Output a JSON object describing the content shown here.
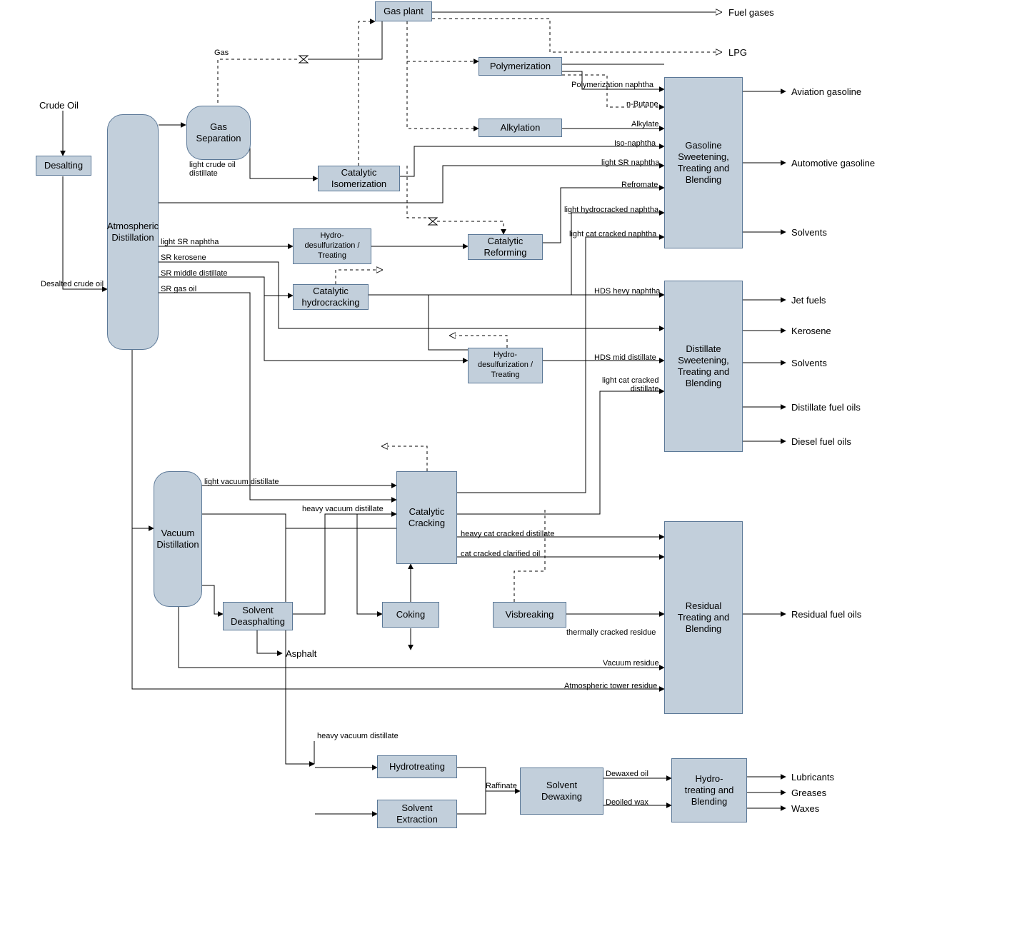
{
  "input": {
    "crude_oil": "Crude Oil"
  },
  "units": {
    "desalting": "Desalting",
    "gas_separation": "Gas\nSeparation",
    "gas_plant": "Gas plant",
    "catalytic_isomerization": "Catalytic\nIsomerization",
    "polymerization": "Polymerization",
    "alkylation": "Alkylation",
    "atmospheric_distillation": "Atmospheric\nDistillation",
    "hydro_desulf_1": "Hydro-\ndesulfurization /\nTreating",
    "catalytic_reforming": "Catalytic\nReforming",
    "catalytic_hydrocracking": "Catalytic\nhydrocracking",
    "hydro_desulf_2": "Hydro-\ndesulfurization /\nTreating",
    "vacuum_distillation": "Vacuum\nDistillation",
    "solvent_deasphalting": "Solvent\nDeasphalting",
    "catalytic_cracking": "Catalytic\nCracking",
    "coking": "Coking",
    "visbreaking": "Visbreaking",
    "hydrotreating": "Hydrotreating",
    "solvent_extraction": "Solvent\nExtraction",
    "solvent_dewaxing": "Solvent\nDewaxing",
    "hydro_treating_blending": "Hydro-\ntreating and\nBlending",
    "gasoline_blend": "Gasoline\nSweetening,\nTreating and\nBlending",
    "distillate_blend": "Distillate\nSweetening,\nTreating and\nBlending",
    "residual_blend": "Residual\nTreating and\nBlending"
  },
  "streams": {
    "gas": "Gas",
    "light_crude_oil_distillate": "light crude oil\ndistillate",
    "desalted_crude": "Desalted crude oil",
    "light_sr_naphtha_1": "light SR naphtha",
    "sr_kerosene": "SR kerosene",
    "sr_mid_dist": "SR middle distillate",
    "sr_gas_oil": "SR gas oil",
    "poly_naphtha": "Polymerization naphtha",
    "n_butane": "n-Butane",
    "alkylate": "Alkylate",
    "iso_naphtha": "Iso-naphtha",
    "light_sr_naphtha_2": "light SR naphtha",
    "refromate": "Refromate",
    "light_hydro_naphtha": "light hydrocracked naphtha",
    "light_cat_naphtha": "light cat cracked naphtha",
    "hds_heavy_naphtha": "HDS hevy naphtha",
    "hds_mid_distillate": "HDS mid distillate",
    "light_cat_distillate": "light cat cracked\ndistillate",
    "light_vac_distillate": "light vacuum distillate",
    "heavy_vac_distillate_1": "heavy vacuum distillate",
    "heavy_cat_distillate": "heavy cat cracked distillate",
    "cat_clarified_oil": "cat cracked clarified oil",
    "therm_cracked_residue": "thermally cracked residue",
    "vacuum_residue": "Vacuum residue",
    "atm_tower_residue": "Atmospheric tower residue",
    "heavy_vac_distillate_2": "heavy vacuum distillate",
    "asphalt": "Asphalt",
    "raffinate": "Raffinate",
    "dewaxed_oil": "Dewaxed oil",
    "deoiled_wax": "Deoiled wax"
  },
  "products": {
    "fuel_gases": "Fuel gases",
    "lpg": "LPG",
    "aviation_gasoline": "Aviation gasoline",
    "automotive_gasoline": "Automotive gasoline",
    "solvents_1": "Solvents",
    "jet_fuels": "Jet fuels",
    "kerosene": "Kerosene",
    "solvents_2": "Solvents",
    "distillate_fuel_oils": "Distillate fuel oils",
    "diesel_fuel_oils": "Diesel fuel oils",
    "residual_fuel_oils": "Residual fuel oils",
    "lubricants": "Lubricants",
    "greases": "Greases",
    "waxes": "Waxes"
  }
}
